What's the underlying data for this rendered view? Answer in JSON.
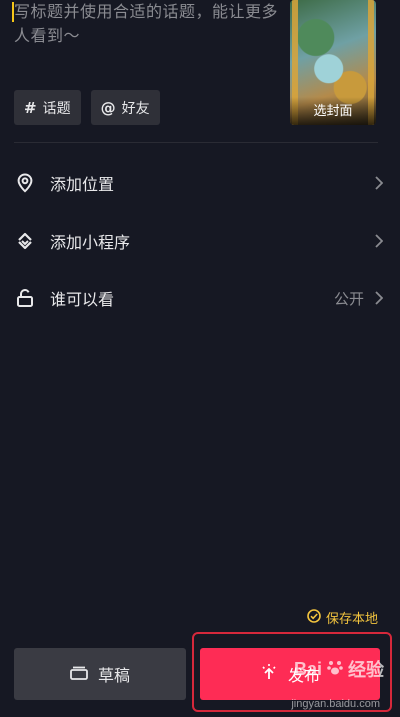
{
  "caption": {
    "placeholder": "写标题并使用合适的话题，能让更多人看到～"
  },
  "cover": {
    "label": "选封面"
  },
  "chips": [
    {
      "icon": "hashtag-icon",
      "symbol": "#",
      "label": "话题"
    },
    {
      "icon": "at-icon",
      "symbol": "@",
      "label": "好友"
    }
  ],
  "settings": [
    {
      "icon": "location-pin-icon",
      "label": "添加位置",
      "value": ""
    },
    {
      "icon": "mini-program-icon",
      "label": "添加小程序",
      "value": ""
    },
    {
      "icon": "unlock-icon",
      "label": "谁可以看",
      "value": "公开"
    }
  ],
  "save_local": {
    "icon": "check-circle-icon",
    "label": "保存本地",
    "color": "#f3c43e"
  },
  "bottom": {
    "draft_label": "草稿",
    "publish_label": "发布",
    "publish_color": "#fe2c55"
  },
  "watermark": {
    "brand": "Bai",
    "brand_suffix": "经验",
    "url": "jingyan.baidu.com"
  }
}
